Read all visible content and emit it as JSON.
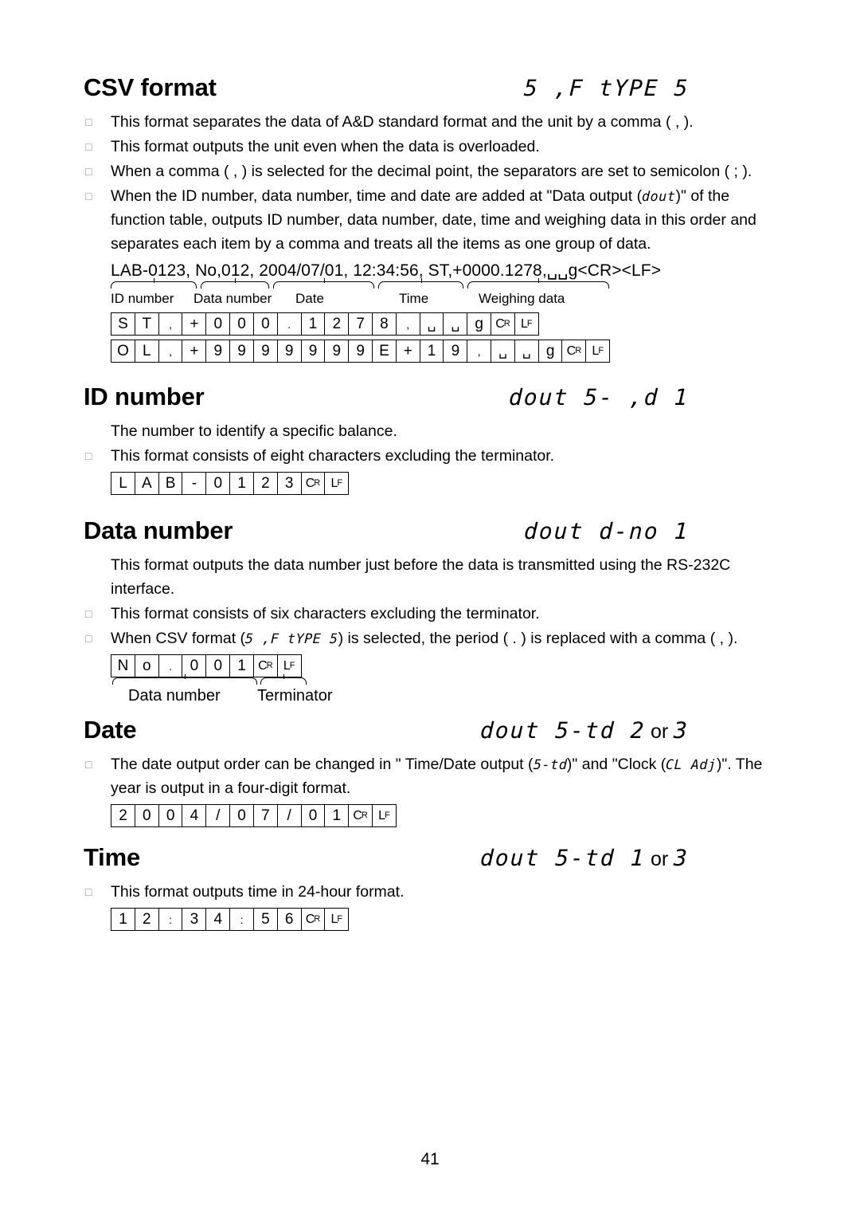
{
  "page": {
    "number": "41"
  },
  "sections": [
    {
      "id": "csv-format",
      "title": "CSV format",
      "code_seg": "S F  E PE 5",
      "code_display": "5 ,F  tYPE 5",
      "bullets": [
        "This format separates the data of A&D standard format and the unit by a comma ( , ).",
        "This format outputs the unit even when the data is overloaded.",
        "When a comma ( , ) is selected for the decimal point, the separators are set to semicolon ( ; )."
      ],
      "bullet4_prefix": "When the ID number, data number, time and date are added at \"Data output (",
      "bullet4_code": "dout",
      "bullet4_suffix": ")\" of the function table, outputs ID number, data number, date, time and weighing data in this order and separates each item by a comma and treats all the items as one group of data.",
      "sample": "LAB-0123, No,012, 2004/07/01, 12:34:56, ST,+0000.1278,␣␣g<CR><LF>",
      "sample_parts": [
        {
          "text": "LAB-0123,",
          "label": "ID number"
        },
        {
          "text": "No,012,",
          "label": "Data number"
        },
        {
          "text": "2004/07/01,",
          "label": "Date"
        },
        {
          "text": "12:34:56,",
          "label": "Time"
        },
        {
          "text": "ST,+0000.1278,",
          "label": "Weighing data"
        },
        {
          "text": "␣␣g<CR><LF>",
          "label": ""
        }
      ],
      "cell_rows": [
        [
          "S",
          "T",
          ",",
          "+",
          "0",
          "0",
          "0",
          ".",
          "1",
          "2",
          "7",
          "8",
          ",",
          "␣",
          "␣",
          "g",
          "CR",
          "LF"
        ],
        [
          "O",
          "L",
          ",",
          "+",
          "9",
          "9",
          "9",
          "9",
          "9",
          "9",
          "9",
          "E",
          "+",
          "1",
          "9",
          ",",
          "␣",
          "␣",
          "g",
          "CR",
          "LF"
        ]
      ]
    },
    {
      "id": "id-number",
      "title": "ID number",
      "code_display": "dout 5- ,d  1",
      "lead": "The number to identify a specific balance.",
      "bullets": [
        "This format consists of eight characters excluding the terminator."
      ],
      "cell_rows": [
        [
          "L",
          "A",
          "B",
          "-",
          "0",
          "1",
          "2",
          "3",
          "CR",
          "LF"
        ]
      ]
    },
    {
      "id": "data-number",
      "title": "Data number",
      "code_display": "dout d-no  1",
      "lead": "This format outputs the data number just before the data is transmitted using the RS-232C interface.",
      "bullets": [
        "This format consists of six characters excluding the terminator."
      ],
      "bullet_csv_prefix": "When CSV format (",
      "bullet_csv_code": "5 ,F  tYPE 5",
      "bullet_csv_suffix": ") is selected, the period ( . ) is replaced with a comma ( , ).",
      "cell_rows": [
        [
          "N",
          "o",
          ".",
          "0",
          "0",
          "1",
          "CR",
          "LF"
        ]
      ],
      "brace_labels": [
        "Data number",
        "Terminator"
      ]
    },
    {
      "id": "date",
      "title": "Date",
      "code_display": "dout 5-td 2",
      "code_or": "or",
      "code_tail": "3",
      "bullet_prefix": "The date output order can be changed in \" Time/Date output (",
      "bullet_code1": "5-td",
      "bullet_mid": ")\" and \"Clock (",
      "bullet_code2": "CL  Adj",
      "bullet_suffix": ")\".",
      "bullet_line2": "The year is output in a four-digit format.",
      "cell_rows": [
        [
          "2",
          "0",
          "0",
          "4",
          "/",
          "0",
          "7",
          "/",
          "0",
          "1",
          "CR",
          "LF"
        ]
      ]
    },
    {
      "id": "time",
      "title": "Time",
      "code_display": "dout 5-td  1",
      "code_or": "or",
      "code_tail": "3",
      "bullets": [
        "This format outputs time in 24-hour format."
      ],
      "cell_rows": [
        [
          "1",
          "2",
          ":",
          "3",
          "4",
          ":",
          "5",
          "6",
          "CR",
          "LF"
        ]
      ]
    }
  ],
  "icons": {
    "bullet": "□"
  }
}
